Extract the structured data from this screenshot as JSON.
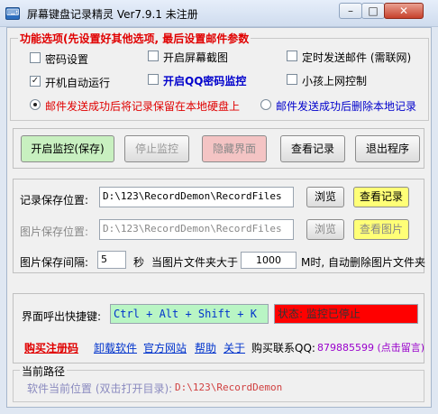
{
  "window": {
    "title": "屏幕键盘记录精灵 Ver7.9.1  未注册",
    "minimize_label": "–",
    "maximize_label": "□",
    "close_label": "✕",
    "app_icon_glyph": "⌨"
  },
  "options": {
    "title": "功能选项(先设置好其他选项, 最后设置邮件参数",
    "password": {
      "label": "密码设置",
      "checked": false
    },
    "screenshot": {
      "label": "开启屏幕截图",
      "checked": false
    },
    "timed_email": {
      "label": "定时发送邮件 (需联网)",
      "checked": false
    },
    "autostart": {
      "label": "开机自动运行",
      "checked": true
    },
    "qq_monitor": {
      "label": "开启QQ密码监控",
      "checked": false
    },
    "kid_control": {
      "label": "小孩上网控制",
      "checked": false
    },
    "radio_keep": {
      "label": "邮件发送成功后将记录保留在本地硬盘上",
      "selected": true
    },
    "radio_delete": {
      "label": "邮件发送成功后删除本地记录",
      "selected": false
    },
    "check_mark": "✓"
  },
  "actions": {
    "start": "开启监控(保存)",
    "stop": "停止监控",
    "hide": "隐藏界面",
    "view": "查看记录",
    "exit": "退出程序"
  },
  "paths": {
    "record_label": "记录保存位置:",
    "record_value": "D:\\123\\RecordDemon\\RecordFiles",
    "record_browse": "浏览",
    "record_view": "查看记录",
    "image_label": "图片保存位置:",
    "image_value": "D:\\123\\RecordDemon\\RecordFiles",
    "image_browse": "浏览",
    "image_view": "查看图片",
    "interval_label": "图片保存间隔:",
    "interval_value": "5",
    "interval_unit": "秒",
    "folder_limit_label": "当图片文件夹大于",
    "folder_limit_value": "1000",
    "folder_limit_suffix": "M时, 自动删除图片文件夹"
  },
  "hotkey": {
    "label": "界面呼出快捷键:",
    "value": "Ctrl + Alt + Shift + K",
    "status": "状态: 监控已停止"
  },
  "links": {
    "buy": "购买注册码",
    "uninstall": "卸载软件",
    "website": "官方网站",
    "help": "帮助",
    "about": "关于",
    "contact_label": "购买联系QQ:",
    "contact_value": "879885599 (点击留言)"
  },
  "current_path": {
    "title": "当前路径",
    "label": "软件当前位置 (双击打开目录):",
    "value": "D:\\123\\RecordDemon"
  },
  "colors": {
    "accent_red": "#e00000",
    "green_button": "#c8f0c0",
    "pink_button": "#f4c4c4",
    "yellow_button": "#ffff77",
    "hotkey_bg": "#b9f5c4",
    "status_bg": "#ff0000",
    "link_blue": "#0033cc",
    "purple": "#9900cc"
  }
}
